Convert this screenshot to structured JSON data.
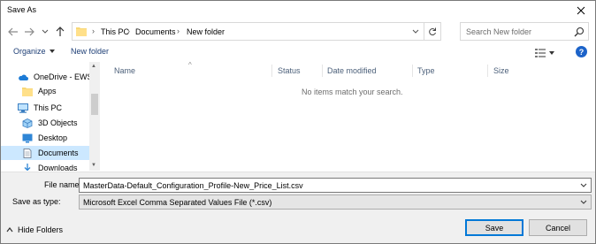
{
  "window": {
    "title": "Save As"
  },
  "address": {
    "crumbs": [
      "This PC",
      "Documents",
      "New folder"
    ]
  },
  "search": {
    "placeholder": "Search New folder"
  },
  "toolbar": {
    "organize_label": "Organize",
    "new_folder_label": "New folder"
  },
  "nav": {
    "items": [
      {
        "label": "OneDrive - EWS G",
        "icon": "cloud-icon"
      },
      {
        "label": "Apps",
        "icon": "folder-icon"
      },
      {
        "label": "This PC",
        "icon": "computer-icon"
      },
      {
        "label": "3D Objects",
        "icon": "cube-icon"
      },
      {
        "label": "Desktop",
        "icon": "desktop-icon"
      },
      {
        "label": "Documents",
        "icon": "document-icon",
        "selected": true
      },
      {
        "label": "Downloads",
        "icon": "download-icon"
      }
    ]
  },
  "columns": [
    "Name",
    "Status",
    "Date modified",
    "Type",
    "Size"
  ],
  "content": {
    "empty_message": "No items match your search."
  },
  "form": {
    "file_name_label": "File name:",
    "file_name_value": "MasterData-Default_Configuration_Profile-New_Price_List.csv",
    "save_type_label": "Save as type:",
    "save_type_value": "Microsoft Excel Comma Separated Values File (*.csv)"
  },
  "footer": {
    "hide_folders_label": "Hide Folders",
    "save_label": "Save",
    "cancel_label": "Cancel"
  },
  "colors": {
    "accent": "#0078d7",
    "selection": "#cce8ff",
    "link_text": "#1e3f76"
  }
}
